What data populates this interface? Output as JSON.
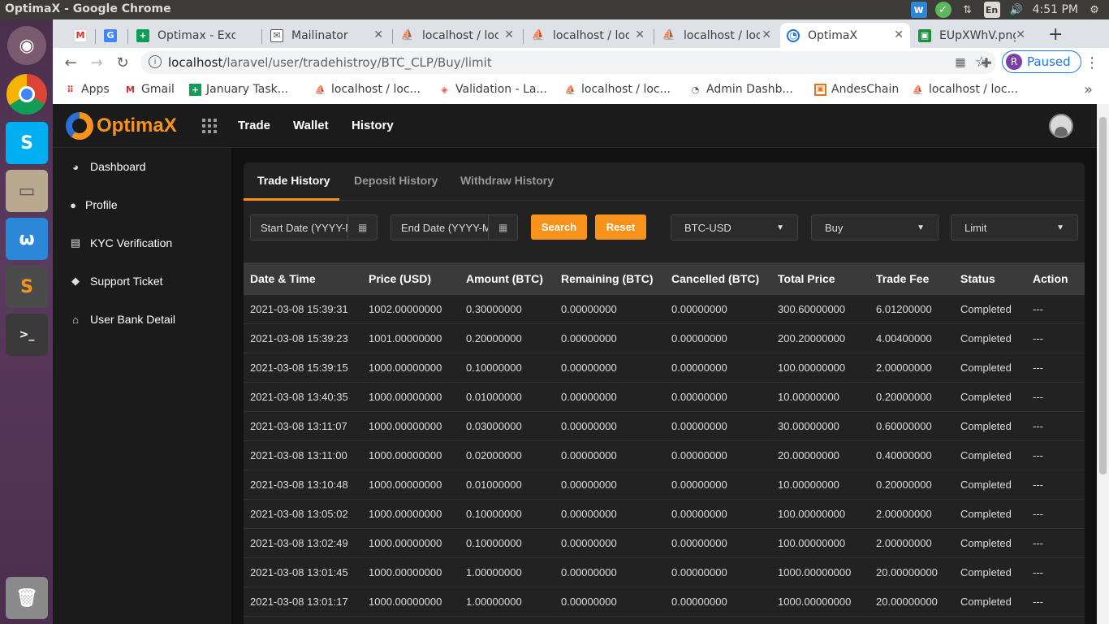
{
  "os": {
    "window_title": "OptimaX - Google Chrome",
    "keyboard": "En",
    "time": "4:51 PM"
  },
  "browser": {
    "tabs": [
      {
        "label": "",
        "icon": "gmail-icon"
      },
      {
        "label": "",
        "icon": "google-translate-icon"
      },
      {
        "label": "Optimax - Excel",
        "icon": "sheets-icon"
      },
      {
        "label": "Mailinator",
        "icon": "mailinator-icon"
      },
      {
        "label": "localhost / localhost",
        "icon": "phpmyadmin-icon"
      },
      {
        "label": "localhost / localhost",
        "icon": "phpmyadmin-icon"
      },
      {
        "label": "localhost / localhost",
        "icon": "phpmyadmin-icon"
      },
      {
        "label": "OptimaX",
        "icon": "optimax-icon"
      },
      {
        "label": "EUpXWhV.png",
        "icon": "image-icon"
      }
    ],
    "url_host": "localhost",
    "url_path": "/laravel/user/tradehistroy/BTC_CLP/Buy/limit",
    "profile_initial": "R",
    "profile_status": "Paused",
    "bookmarks": [
      {
        "label": "Apps",
        "icon": "apps-icon"
      },
      {
        "label": "Gmail",
        "icon": "gmail-icon"
      },
      {
        "label": "January Task...",
        "icon": "sheets-icon"
      },
      {
        "label": "localhost / loc...",
        "icon": "phpmyadmin-icon"
      },
      {
        "label": "Validation - La...",
        "icon": "laravel-icon"
      },
      {
        "label": "localhost / loc...",
        "icon": "phpmyadmin-icon"
      },
      {
        "label": "Admin Dashb...",
        "icon": "dashboard-icon"
      },
      {
        "label": "AndesChain",
        "icon": "andeschain-icon"
      },
      {
        "label": "localhost / loc...",
        "icon": "phpmyadmin-icon"
      }
    ]
  },
  "app": {
    "logo_text_a": "Optima",
    "logo_text_b": "X",
    "nav": [
      "Trade",
      "Wallet",
      "History"
    ],
    "sidebar": [
      {
        "label": "Dashboard",
        "icon": "dashboard-icon"
      },
      {
        "label": "Profile",
        "icon": "user-icon"
      },
      {
        "label": "KYC Verification",
        "icon": "id-card-icon"
      },
      {
        "label": "Support Ticket",
        "icon": "ticket-icon"
      },
      {
        "label": "User Bank Detail",
        "icon": "bank-icon"
      }
    ],
    "tabs": [
      "Trade History",
      "Deposit History",
      "Withdraw History"
    ],
    "active_tab": "Trade History",
    "filters": {
      "start_placeholder": "Start Date (YYYY-MM-DD)",
      "end_placeholder": "End Date (YYYY-MM-DD)",
      "search_label": "Search",
      "reset_label": "Reset",
      "pair": "BTC-USD",
      "side": "Buy",
      "order_type": "Limit"
    },
    "columns": [
      "Date & Time",
      "Price (USD)",
      "Amount (BTC)",
      "Remaining (BTC)",
      "Cancelled (BTC)",
      "Total Price",
      "Trade Fee",
      "Status",
      "Action"
    ],
    "rows": [
      [
        "2021-03-08 15:39:31",
        "1002.00000000",
        "0.30000000",
        "0.00000000",
        "0.00000000",
        "300.60000000",
        "6.01200000",
        "Completed",
        "---"
      ],
      [
        "2021-03-08 15:39:23",
        "1001.00000000",
        "0.20000000",
        "0.00000000",
        "0.00000000",
        "200.20000000",
        "4.00400000",
        "Completed",
        "---"
      ],
      [
        "2021-03-08 15:39:15",
        "1000.00000000",
        "0.10000000",
        "0.00000000",
        "0.00000000",
        "100.00000000",
        "2.00000000",
        "Completed",
        "---"
      ],
      [
        "2021-03-08 13:40:35",
        "1000.00000000",
        "0.01000000",
        "0.00000000",
        "0.00000000",
        "10.00000000",
        "0.20000000",
        "Completed",
        "---"
      ],
      [
        "2021-03-08 13:11:07",
        "1000.00000000",
        "0.03000000",
        "0.00000000",
        "0.00000000",
        "30.00000000",
        "0.60000000",
        "Completed",
        "---"
      ],
      [
        "2021-03-08 13:11:00",
        "1000.00000000",
        "0.02000000",
        "0.00000000",
        "0.00000000",
        "20.00000000",
        "0.40000000",
        "Completed",
        "---"
      ],
      [
        "2021-03-08 13:10:48",
        "1000.00000000",
        "0.01000000",
        "0.00000000",
        "0.00000000",
        "10.00000000",
        "0.20000000",
        "Completed",
        "---"
      ],
      [
        "2021-03-08 13:05:02",
        "1000.00000000",
        "0.10000000",
        "0.00000000",
        "0.00000000",
        "100.00000000",
        "2.00000000",
        "Completed",
        "---"
      ],
      [
        "2021-03-08 13:02:49",
        "1000.00000000",
        "0.10000000",
        "0.00000000",
        "0.00000000",
        "100.00000000",
        "2.00000000",
        "Completed",
        "---"
      ],
      [
        "2021-03-08 13:01:45",
        "1000.00000000",
        "1.00000000",
        "0.00000000",
        "0.00000000",
        "1000.00000000",
        "20.00000000",
        "Completed",
        "---"
      ],
      [
        "2021-03-08 13:01:17",
        "1000.00000000",
        "1.00000000",
        "0.00000000",
        "0.00000000",
        "1000.00000000",
        "20.00000000",
        "Completed",
        "---"
      ]
    ]
  },
  "colors": {
    "accent": "#f7931a",
    "page_bg": "#1b1b1b",
    "panel_bg": "#222222"
  }
}
